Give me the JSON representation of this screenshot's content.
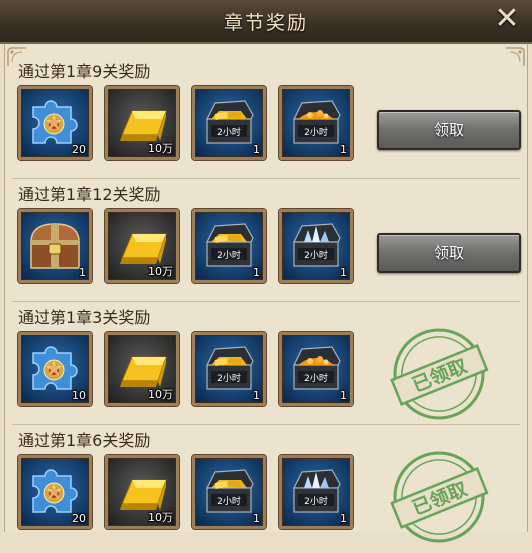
{
  "title": "章节奖励",
  "close_icon": "close-x-icon",
  "sections": [
    {
      "title": "通过第1章9关奖励",
      "status": "claimable",
      "button_label": "领取",
      "items": [
        {
          "icon": "puzzle-piece-icon",
          "count": "20"
        },
        {
          "icon": "gold-bar-icon",
          "count": "10万"
        },
        {
          "icon": "gold-chest-2h-icon",
          "count": "1",
          "tag": "2小时"
        },
        {
          "icon": "orange-chest-2h-icon",
          "count": "1",
          "tag": "2小时"
        }
      ]
    },
    {
      "title": "通过第1章12关奖励",
      "status": "claimable",
      "button_label": "领取",
      "items": [
        {
          "icon": "treasure-chest-icon",
          "count": "1"
        },
        {
          "icon": "gold-bar-icon",
          "count": "10万"
        },
        {
          "icon": "gold-chest-2h-icon",
          "count": "1",
          "tag": "2小时"
        },
        {
          "icon": "crystal-chest-2h-icon",
          "count": "1",
          "tag": "2小时"
        }
      ]
    },
    {
      "title": "通过第1章3关奖励",
      "status": "claimed",
      "stamp_label": "已领取",
      "items": [
        {
          "icon": "puzzle-piece-icon",
          "count": "10"
        },
        {
          "icon": "gold-bar-icon",
          "count": "10万"
        },
        {
          "icon": "gold-chest-2h-icon",
          "count": "1",
          "tag": "2小时"
        },
        {
          "icon": "orange-chest-2h-icon",
          "count": "1",
          "tag": "2小时"
        }
      ]
    },
    {
      "title": "通过第1章6关奖励",
      "status": "claimed",
      "stamp_label": "已领取",
      "items": [
        {
          "icon": "puzzle-piece-icon",
          "count": "20"
        },
        {
          "icon": "gold-bar-icon",
          "count": "10万"
        },
        {
          "icon": "gold-chest-2h-icon",
          "count": "1",
          "tag": "2小时"
        },
        {
          "icon": "crystal-chest-2h-icon",
          "count": "1",
          "tag": "2小时"
        }
      ]
    }
  ],
  "colors": {
    "accent_gold": "#f0b820",
    "stamp_green": "#4f9a45",
    "slot_blue": "#123a66"
  }
}
